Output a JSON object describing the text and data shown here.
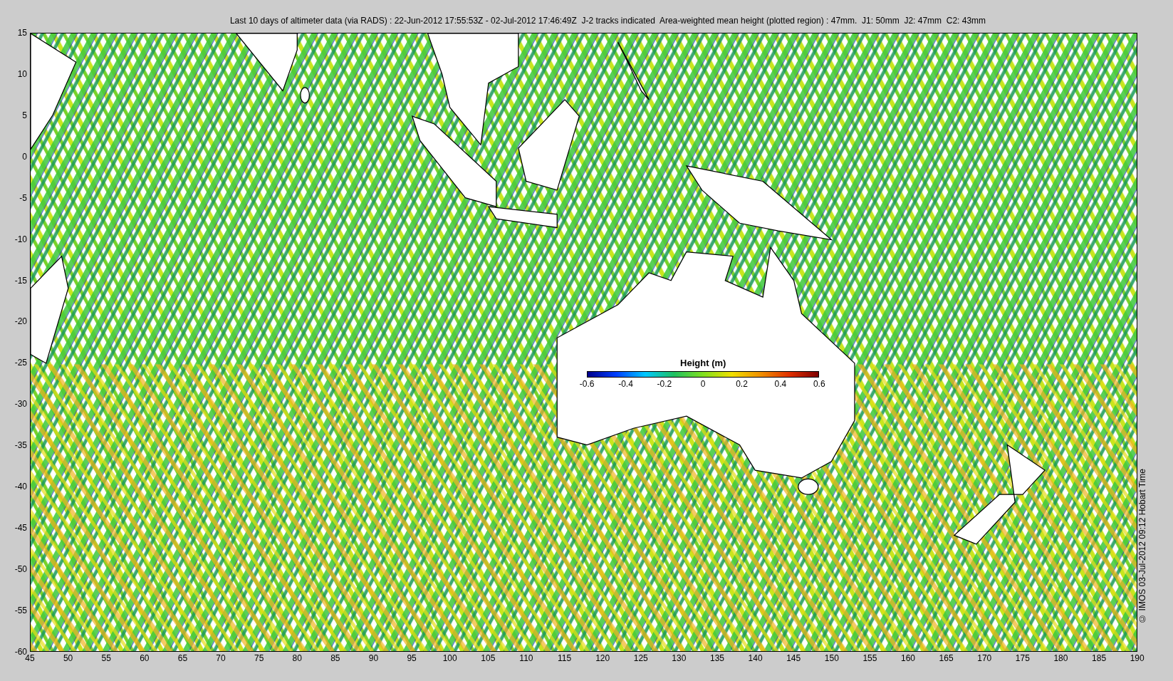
{
  "title": "Last 10 days of altimeter data (via RADS) : 22-Jun-2012 17:55:53Z - 02-Jul-2012 17:46:49Z  J-2 tracks indicated  Area-weighted mean height (plotted region) : 47mm.  J1: 50mm  J2: 47mm  C2: 43mm",
  "y_ticks": [
    "15",
    "10",
    "5",
    "0",
    "-5",
    "-10",
    "-15",
    "-20",
    "-25",
    "-30",
    "-35",
    "-40",
    "-45",
    "-50",
    "-55",
    "-60"
  ],
  "x_ticks": [
    "45",
    "50",
    "55",
    "60",
    "65",
    "70",
    "75",
    "80",
    "85",
    "90",
    "95",
    "100",
    "105",
    "110",
    "115",
    "120",
    "125",
    "130",
    "135",
    "140",
    "145",
    "150",
    "155",
    "160",
    "165",
    "170",
    "175",
    "180",
    "185",
    "190"
  ],
  "colorbar": {
    "title": "Height (m)",
    "ticks": [
      "-0.6",
      "-0.4",
      "-0.2",
      "0",
      "0.2",
      "0.4",
      "0.6"
    ]
  },
  "credit": "© IMOS 03-Jul-2012 09:12 Hobart Time"
}
